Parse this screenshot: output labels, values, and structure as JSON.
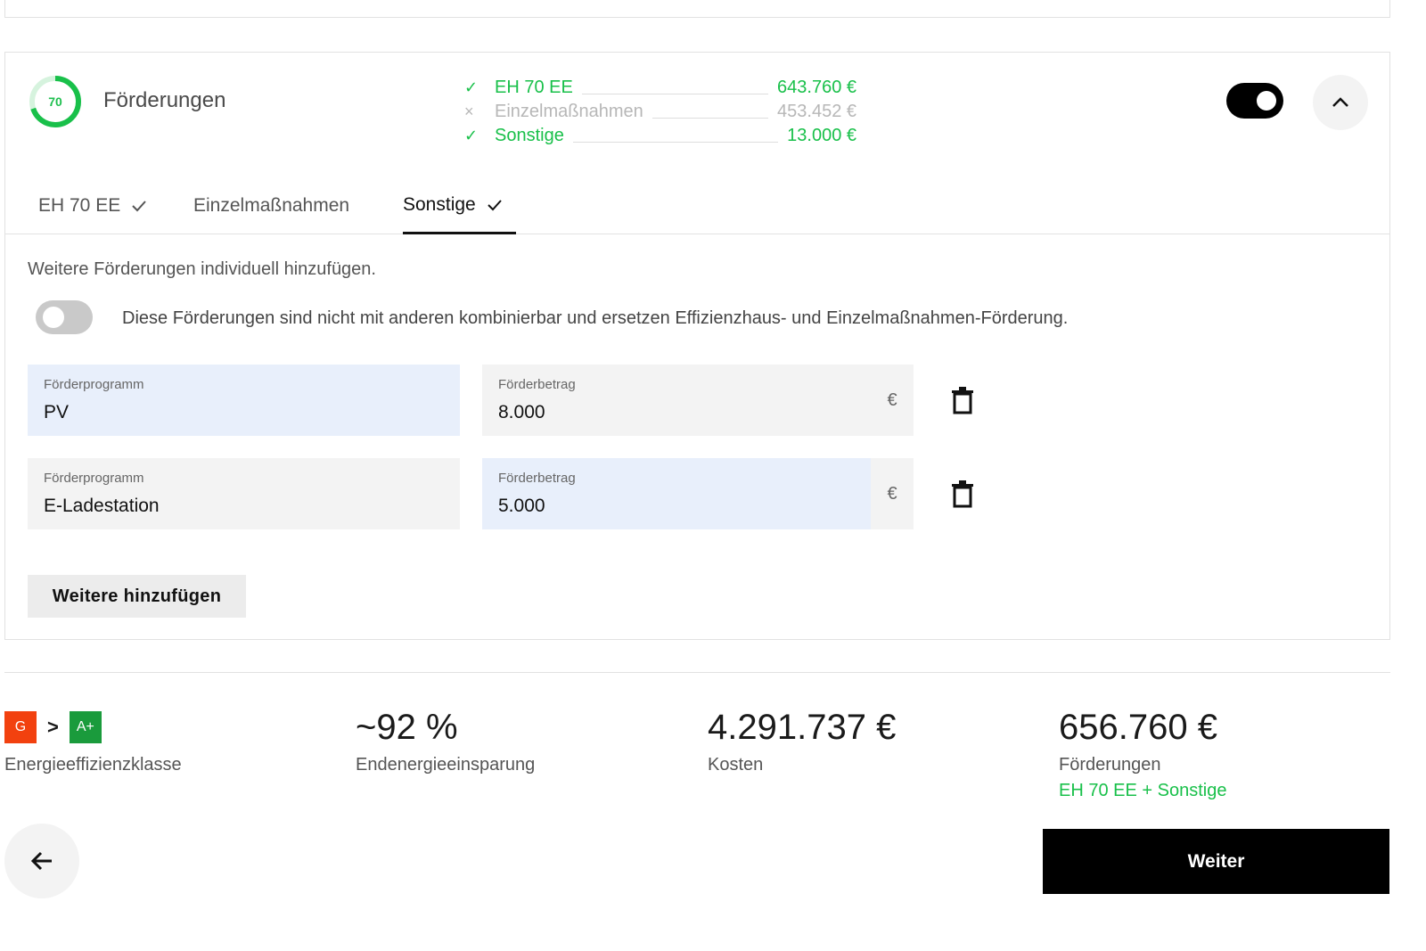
{
  "card": {
    "ring_value": "70",
    "title": "Förderungen",
    "progress_fraction": 0.7,
    "summary": [
      {
        "name": "EH 70 EE",
        "amount": "643.760 €",
        "active": true,
        "mark": "✓"
      },
      {
        "name": "Einzelmaßnahmen",
        "amount": "453.452 €",
        "active": false,
        "mark": "×"
      },
      {
        "name": "Sonstige",
        "amount": "13.000 €",
        "active": true,
        "mark": "✓"
      }
    ],
    "main_toggle_on": true
  },
  "tabs": [
    {
      "label": "EH 70 EE",
      "checked": true,
      "active": false
    },
    {
      "label": "Einzelmaßnahmen",
      "checked": false,
      "active": false
    },
    {
      "label": "Sonstige",
      "checked": true,
      "active": true
    }
  ],
  "sonstige": {
    "intro": "Weitere Förderungen individuell hinzufügen.",
    "toggle_on": false,
    "toggle_desc": "Diese Förderungen sind nicht mit anderen kombinierbar und ersetzen Effizienzhaus- und Einzelmaßnahmen-Förderung.",
    "rows": [
      {
        "program_label": "Förderprogramm",
        "program_value": "PV",
        "amount_label": "Förderbetrag",
        "amount_value": "8.000",
        "unit": "€"
      },
      {
        "program_label": "Förderprogramm",
        "program_value": "E-Ladestation",
        "amount_label": "Förderbetrag",
        "amount_value": "5.000",
        "unit": "€"
      }
    ],
    "add_button": "Weitere hinzufügen"
  },
  "stats": {
    "class_from": "G",
    "class_to": "A+",
    "class_arrow": ">",
    "class_caption": "Energieeffizienzklasse",
    "savings_value": "~92 %",
    "savings_caption": "Endenergieeinsparung",
    "cost_value": "4.291.737 €",
    "cost_caption": "Kosten",
    "funding_value": "656.760 €",
    "funding_caption": "Förderungen",
    "funding_sub": "EH 70 EE + Sonstige"
  },
  "nav": {
    "next_label": "Weiter"
  },
  "colors": {
    "accent_green": "#19c04a",
    "class_from_color": "#f2410f",
    "class_to_color": "#1a9b3c",
    "field_focus": "#e8effb",
    "field_bg": "#f3f3f3"
  }
}
